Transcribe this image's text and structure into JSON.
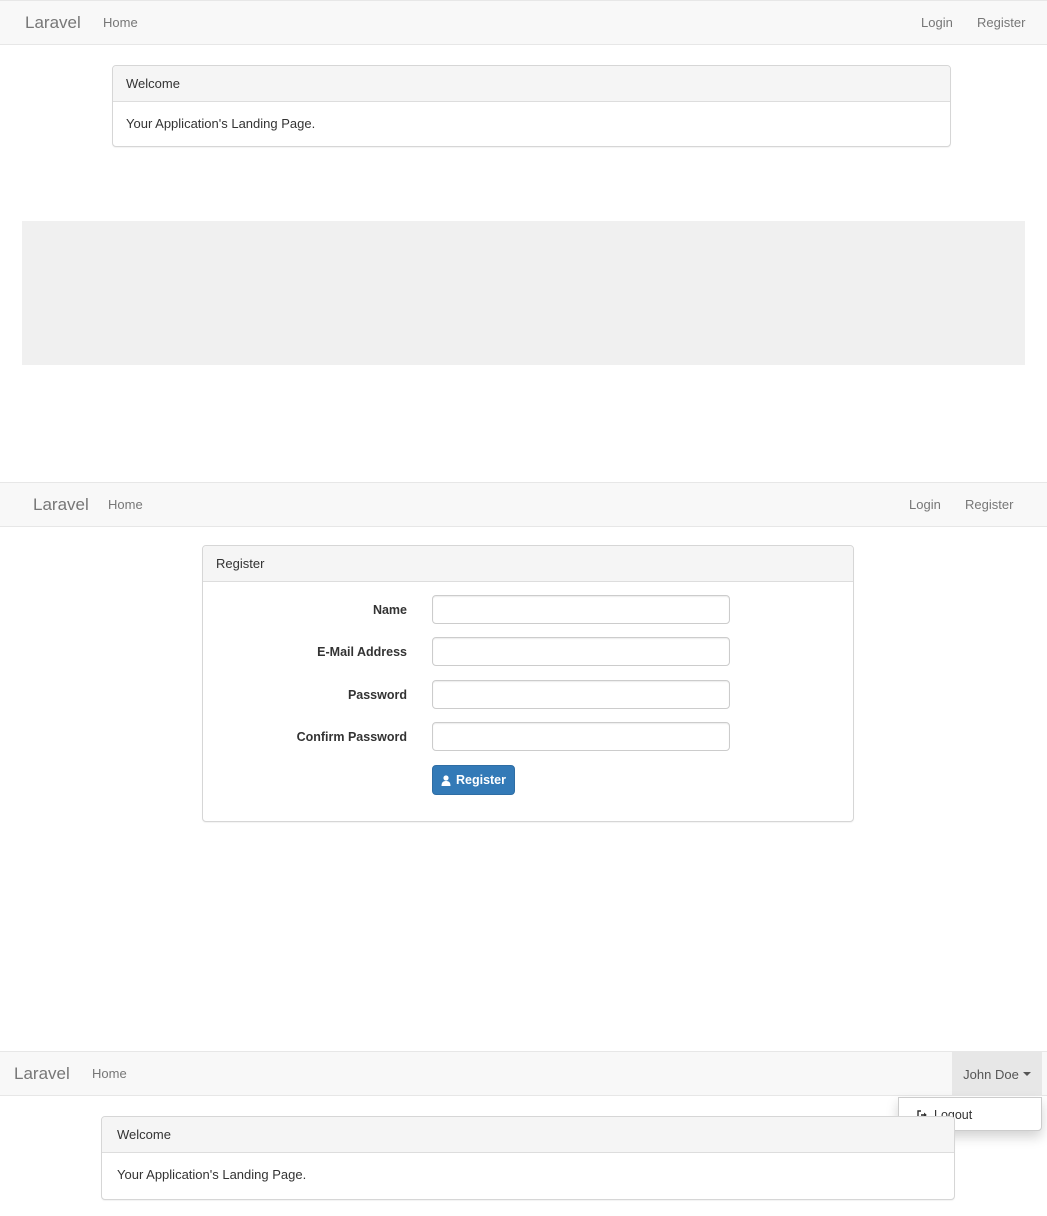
{
  "screen1": {
    "brand": "Laravel",
    "nav": {
      "home": "Home",
      "login": "Login",
      "register": "Register"
    },
    "panel": {
      "heading": "Welcome",
      "body": "Your Application's Landing Page."
    }
  },
  "screen2": {
    "brand": "Laravel",
    "nav": {
      "home": "Home",
      "login": "Login",
      "register": "Register"
    },
    "panel": {
      "heading": "Register",
      "fields": [
        {
          "label": "Name",
          "value": ""
        },
        {
          "label": "E-Mail Address",
          "value": ""
        },
        {
          "label": "Password",
          "value": ""
        },
        {
          "label": "Confirm Password",
          "value": ""
        }
      ],
      "submit_label": "Register",
      "submit_icon": "user-icon",
      "accent": "#337ab7"
    }
  },
  "screen3": {
    "brand": "Laravel",
    "nav": {
      "home": "Home"
    },
    "user_menu": {
      "label": "John Doe",
      "items": [
        {
          "label": "Logout",
          "icon": "sign-out-icon"
        }
      ]
    },
    "panel": {
      "heading": "Welcome",
      "body": "Your Application's Landing Page."
    }
  }
}
